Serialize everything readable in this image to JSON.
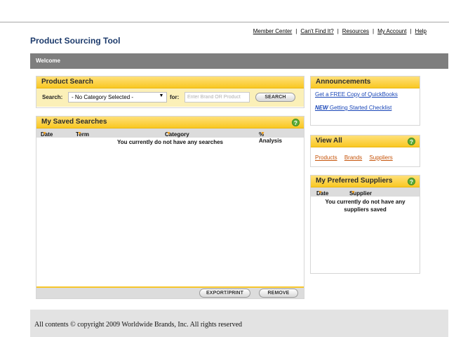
{
  "header": {
    "app_title": "Product Sourcing Tool",
    "nav": [
      "Member Center",
      "Can't Find It?",
      "Resources",
      "My Account",
      "Help"
    ],
    "nav_separator": "|"
  },
  "welcome": {
    "label": "Welcome"
  },
  "product_search": {
    "title": "Product Search",
    "search_label": "Search:",
    "category_selected": "- No Category Selected -",
    "for_label": "for:",
    "input_placeholder": "Enter Brand OR Product",
    "search_button": "SEARCH"
  },
  "saved_searches": {
    "title": "My Saved Searches",
    "help": "?",
    "columns": [
      "Date",
      "Term",
      "Category",
      "% Analysis"
    ],
    "empty_message": "You currently do not have any searches",
    "export_button": "EXPORT/PRINT",
    "remove_button": "REMOVE"
  },
  "announcements": {
    "title": "Announcements",
    "link1": "Get a FREE Copy of QuickBooks",
    "link2_new": "NEW",
    "link2_text": " Getting Started Checklist"
  },
  "view_all": {
    "title": "View All",
    "help": "?",
    "links": [
      "Products",
      "Brands",
      "Suppliers"
    ]
  },
  "preferred_suppliers": {
    "title": "My Preferred Suppliers",
    "help": "?",
    "columns": [
      "Date",
      "Supplier"
    ],
    "empty_message": "You currently do not have any suppliers saved"
  },
  "footer": {
    "text": "All contents © copyright 2009 Worldwide Brands, Inc. All rights reserved"
  },
  "colors": {
    "panel_header": "#f9c823",
    "title_blue": "#1c3a6b",
    "link_blue": "#1a47b8",
    "link_orange": "#c6540a",
    "welcome_bar": "#7e7e7e",
    "help_green": "#5fae3a"
  }
}
